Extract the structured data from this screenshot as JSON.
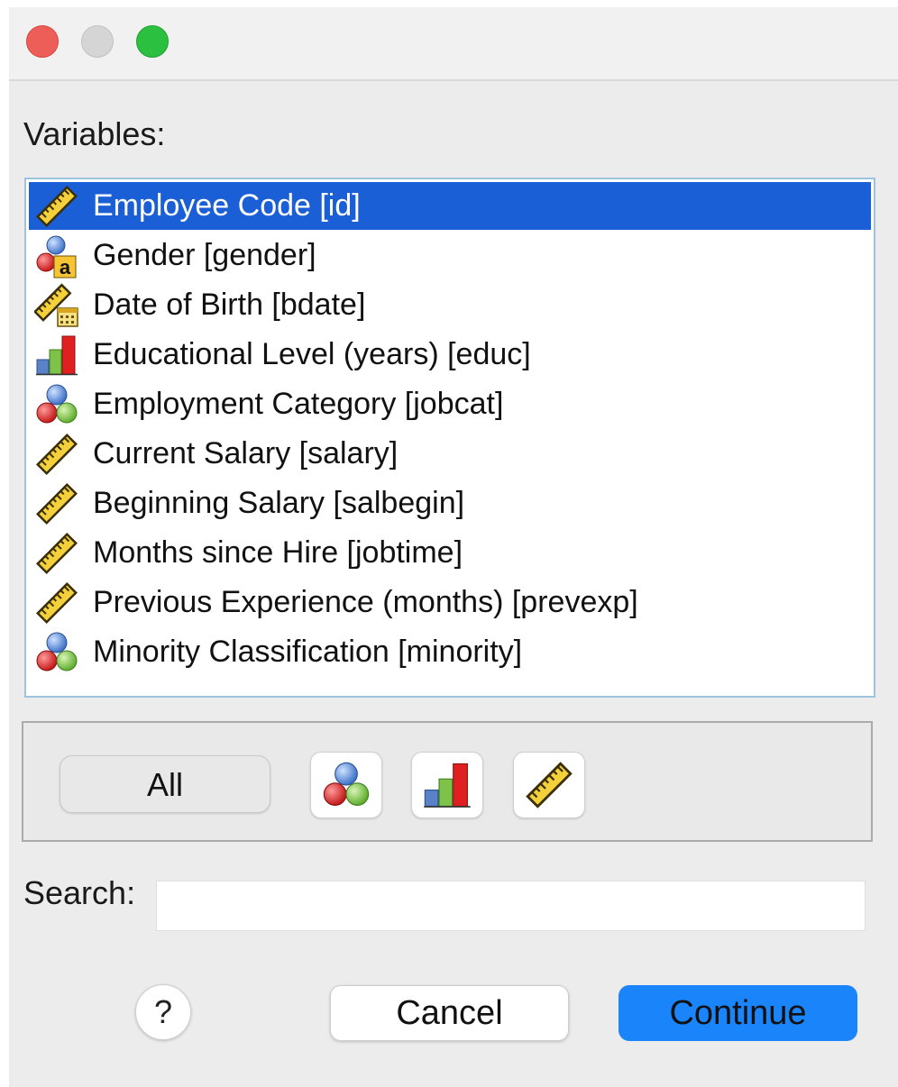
{
  "window": {
    "controls": [
      "close",
      "minimize",
      "maximize"
    ]
  },
  "variables": {
    "label": "Variables:",
    "items": [
      {
        "label": "Employee Code [id]",
        "icon": "scale-ruler-icon",
        "selected": true
      },
      {
        "label": "Gender [gender]",
        "icon": "nominal-string-icon",
        "selected": false
      },
      {
        "label": "Date of Birth [bdate]",
        "icon": "scale-date-icon",
        "selected": false
      },
      {
        "label": "Educational Level (years) [educ]",
        "icon": "ordinal-bars-icon",
        "selected": false
      },
      {
        "label": "Employment Category [jobcat]",
        "icon": "nominal-circles-icon",
        "selected": false
      },
      {
        "label": "Current Salary [salary]",
        "icon": "scale-ruler-icon",
        "selected": false
      },
      {
        "label": "Beginning Salary [salbegin]",
        "icon": "scale-ruler-icon",
        "selected": false
      },
      {
        "label": "Months since Hire [jobtime]",
        "icon": "scale-ruler-icon",
        "selected": false
      },
      {
        "label": "Previous Experience (months) [prevexp]",
        "icon": "scale-ruler-icon",
        "selected": false
      },
      {
        "label": "Minority Classification [minority]",
        "icon": "nominal-circles-icon",
        "selected": false
      }
    ]
  },
  "filter": {
    "all_label": "All",
    "buttons": [
      "nominal-circles-icon",
      "ordinal-bars-icon",
      "scale-ruler-icon"
    ]
  },
  "search": {
    "label": "Search:",
    "value": "",
    "placeholder": ""
  },
  "footer": {
    "help_label": "?",
    "cancel_label": "Cancel",
    "continue_label": "Continue"
  },
  "colors": {
    "selection": "#1a5fd6",
    "continue_button": "#1a85fb",
    "list_border": "#9cc3e0"
  }
}
